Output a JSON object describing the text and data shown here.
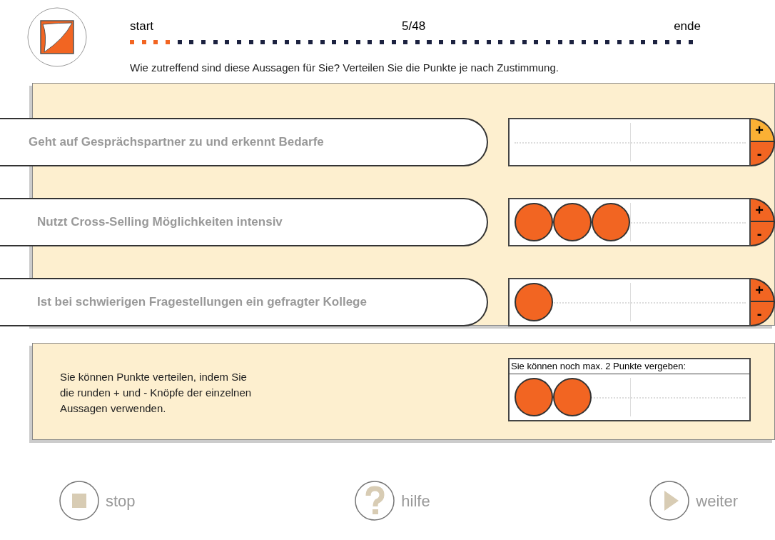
{
  "progress": {
    "start_label": "start",
    "counter": "5/48",
    "end_label": "ende",
    "level": 0.0833
  },
  "instruction": "Wie zutreffend sind diese Aussagen für Sie? Verteilen Sie die Punkte je nach Zustimmung.",
  "statements": [
    {
      "text": "Geht auf Gesprächspartner zu und erkennt Bedarfe",
      "plus_label": "+",
      "minus_label": "-",
      "plus_highlighted": true
    },
    {
      "text": "Nutzt Cross-Selling Möglichkeiten intensiv",
      "tokens": [
        {
          "kind": "dot"
        },
        {
          "kind": "dot"
        },
        {
          "kind": "dot"
        }
      ],
      "plus_label": "+",
      "minus_label": "-",
      "plus_highlighted": false
    },
    {
      "text": "Ist bei schwierigen Fragestellungen ein gefragter Kollege",
      "tokens": [
        {
          "kind": "dot"
        }
      ],
      "plus_label": "+",
      "minus_label": "-",
      "plus_highlighted": false
    }
  ],
  "hint": {
    "text": "Sie können Punkte verteilen, indem Sie die runden + und - Knöpfe der einzelnen Aussagen verwenden.",
    "remaining_title": "Sie können noch max. 2 Punkte vergeben:",
    "tokens": [
      {
        "kind": "dot"
      },
      {
        "kind": "dot"
      }
    ]
  },
  "footer": [
    {
      "kind": "stop",
      "label": "stop"
    },
    {
      "kind": "help",
      "label": "hilfe"
    },
    {
      "kind": "next",
      "label": "weiter"
    }
  ]
}
